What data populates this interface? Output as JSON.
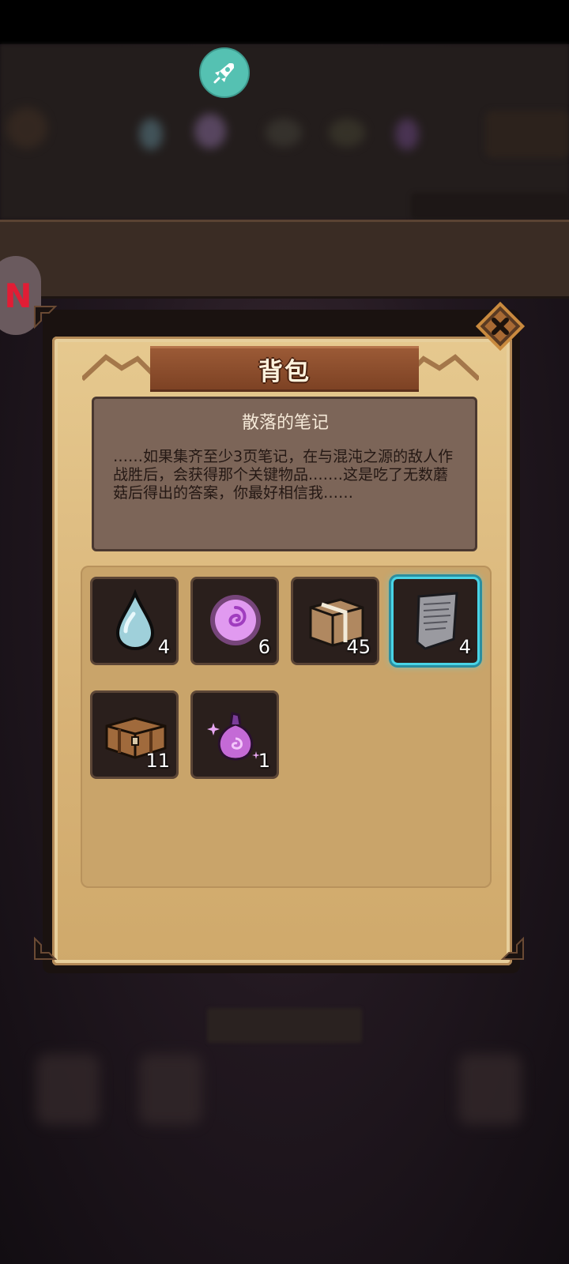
{
  "panel": {
    "title": "背包",
    "close_icon": "close-x-icon"
  },
  "item_detail": {
    "name": "散落的笔记",
    "description": "……如果集齐至少3页笔记，在与混沌之源的敌人作战胜后，会获得那个关键物品.……这是吃了无数蘑菇后得出的答案，你最好相信我……"
  },
  "inventory": {
    "items": [
      {
        "icon": "water-drop-icon",
        "count": "4"
      },
      {
        "icon": "purple-swirl-orb-icon",
        "count": "6"
      },
      {
        "icon": "gift-box-icon",
        "count": "45"
      },
      {
        "icon": "scroll-note-icon",
        "count": "4",
        "selected": true
      },
      {
        "icon": "wooden-chest-icon",
        "count": "11"
      },
      {
        "icon": "magic-pouch-icon",
        "count": "1"
      }
    ]
  },
  "overlay": {
    "rocket_icon": "rocket-icon",
    "side_badge_icon": "red-n-badge-icon"
  },
  "colors": {
    "selection": "#49d4e6",
    "panel_parchment": "#e6c98f",
    "title_banner": "#8a4b2b",
    "rocket_button": "#55c1b2"
  }
}
